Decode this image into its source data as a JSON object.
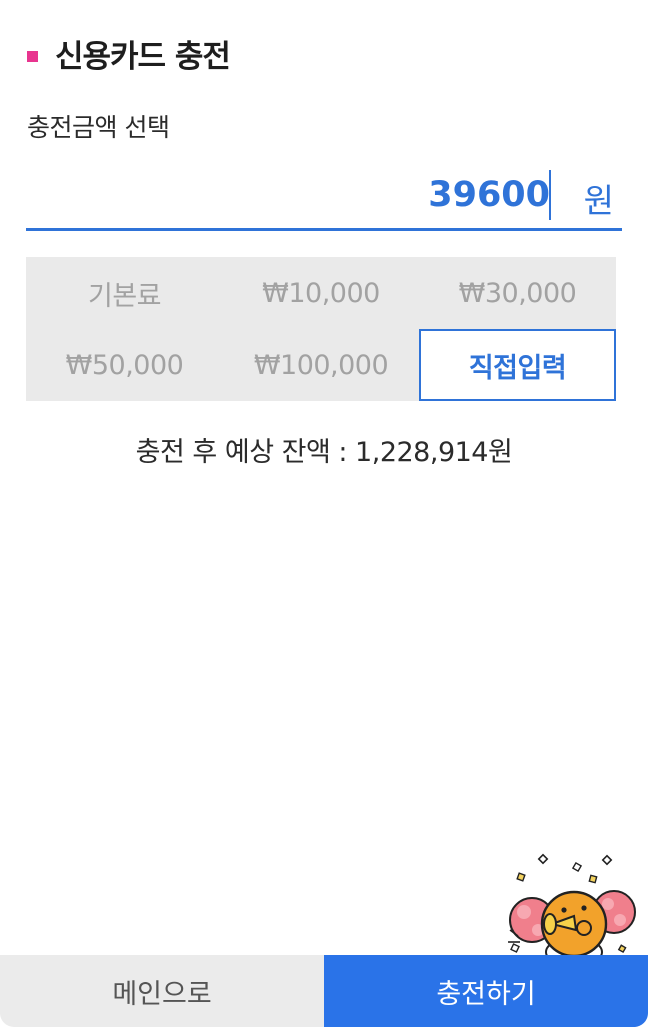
{
  "header": {
    "title": "신용카드 충전",
    "marker_color": "#e8358f"
  },
  "amount": {
    "label": "충전금액 선택",
    "value": "39600",
    "unit": "원"
  },
  "presets": [
    {
      "label": "기본료",
      "selected": false
    },
    {
      "label": "₩10,000",
      "selected": false
    },
    {
      "label": "₩30,000",
      "selected": false
    },
    {
      "label": "₩50,000",
      "selected": false
    },
    {
      "label": "₩100,000",
      "selected": false
    },
    {
      "label": "직접입력",
      "selected": true
    }
  ],
  "balance": {
    "text": "충전 후 예상 잔액 : 1,228,914원"
  },
  "footer": {
    "main_label": "메인으로",
    "charge_label": "충전하기"
  },
  "colors": {
    "accent": "#2f73d8",
    "primary_button": "#2a73e8",
    "preset_bg": "#eaeaea"
  },
  "icons": {
    "mascot": "cheering-lion-mascot-icon"
  }
}
